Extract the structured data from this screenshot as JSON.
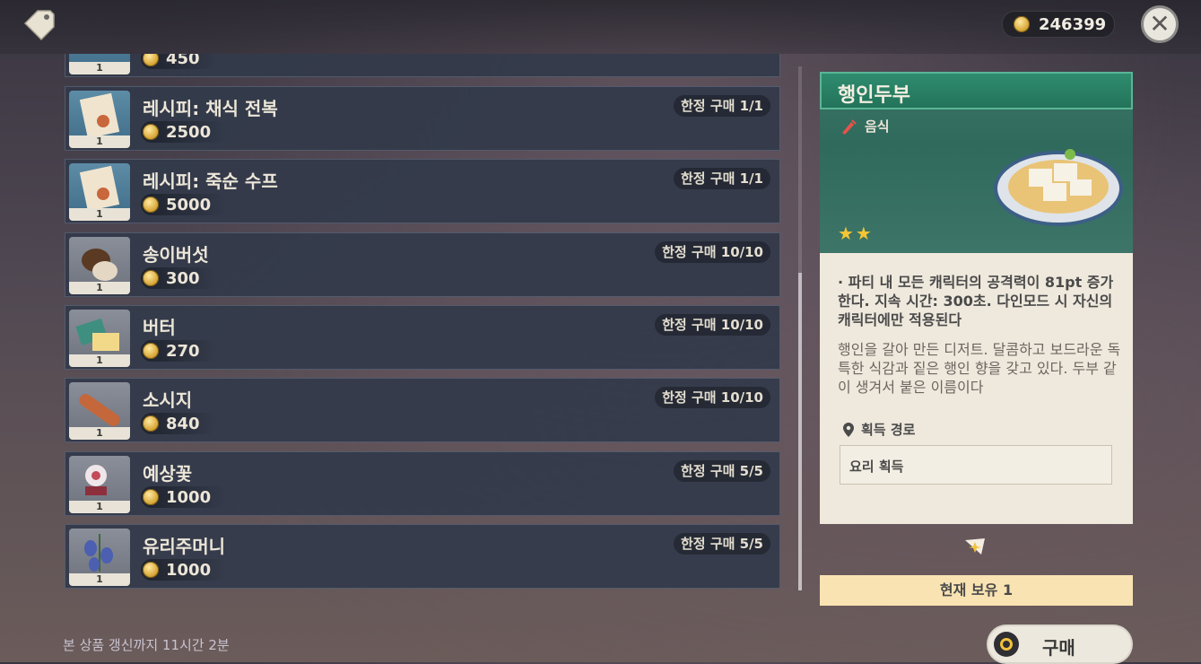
{
  "header": {
    "currency_amount": "246399",
    "shop_icon": "price-tag-icon",
    "close_icon": "close-icon"
  },
  "list": {
    "items": [
      {
        "name": "",
        "qty": "1",
        "price": "450",
        "limit": "",
        "icon": "recipe-icon"
      },
      {
        "name": "레시피: 채식 전복",
        "qty": "1",
        "price": "2500",
        "limit": "한정 구매 1/1",
        "icon": "recipe-icon"
      },
      {
        "name": "레시피: 죽순 수프",
        "qty": "1",
        "price": "5000",
        "limit": "한정 구매 1/1",
        "icon": "recipe-icon"
      },
      {
        "name": "송이버섯",
        "qty": "1",
        "price": "300",
        "limit": "한정 구매 10/10",
        "icon": "mushroom-icon"
      },
      {
        "name": "버터",
        "qty": "1",
        "price": "270",
        "limit": "한정 구매 10/10",
        "icon": "butter-icon"
      },
      {
        "name": "소시지",
        "qty": "1",
        "price": "840",
        "limit": "한정 구매 10/10",
        "icon": "sausage-icon"
      },
      {
        "name": "예상꽃",
        "qty": "1",
        "price": "1000",
        "limit": "한정 구매 5/5",
        "icon": "flower-icon"
      },
      {
        "name": "유리주머니",
        "qty": "1",
        "price": "1000",
        "limit": "한정 구매 5/5",
        "icon": "bellflower-icon"
      }
    ]
  },
  "footer_note": "본 상품 갱신까지 11시간 2분",
  "detail": {
    "title": "행인두부",
    "category": "음식",
    "rarity": 2,
    "stars": "★★",
    "effect": "· 파티 내 모든 캐릭터의 공격력이 81pt 증가한다. 지속 시간: 300초. 다인모드 시 자신의 캐릭터에만 적용된다",
    "description": "행인을 갈아 만든 디저트. 달콤하고 보드라운 독특한 식감과 짙은 행인 향을 갖고 있다. 두부 같이 생겨서 붙은 이름이다",
    "source_label": "획득 경로",
    "source_value": "요리 획득"
  },
  "owned_text": "현재 보유 1",
  "buy_label": "구매",
  "colors": {
    "accent_green": "#2f8c6f",
    "star_gold": "#f6c533",
    "owned_bg": "#f9e3b3"
  }
}
